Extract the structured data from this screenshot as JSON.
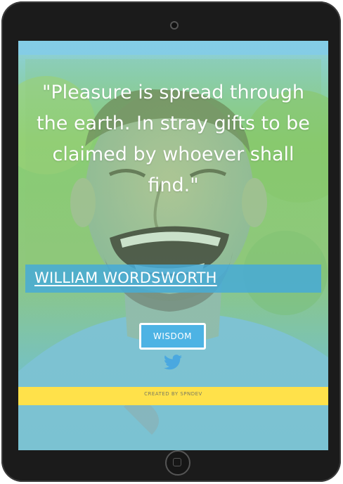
{
  "quote": {
    "text": "\"Pleasure is spread through the earth. In stray gifts to be claimed by whoever shall find.\""
  },
  "author": {
    "name": "WILLIAM WORDSWORTH"
  },
  "actions": {
    "wisdom_label": "WISDOM",
    "share_icon": "twitter-icon"
  },
  "footer": {
    "credit": "CREATED BY SPNDEV"
  },
  "colors": {
    "author_bar": "#46aad7",
    "button": "#4db3e4",
    "twitter": "#4aa8e0",
    "strip": "#ffe14a"
  }
}
